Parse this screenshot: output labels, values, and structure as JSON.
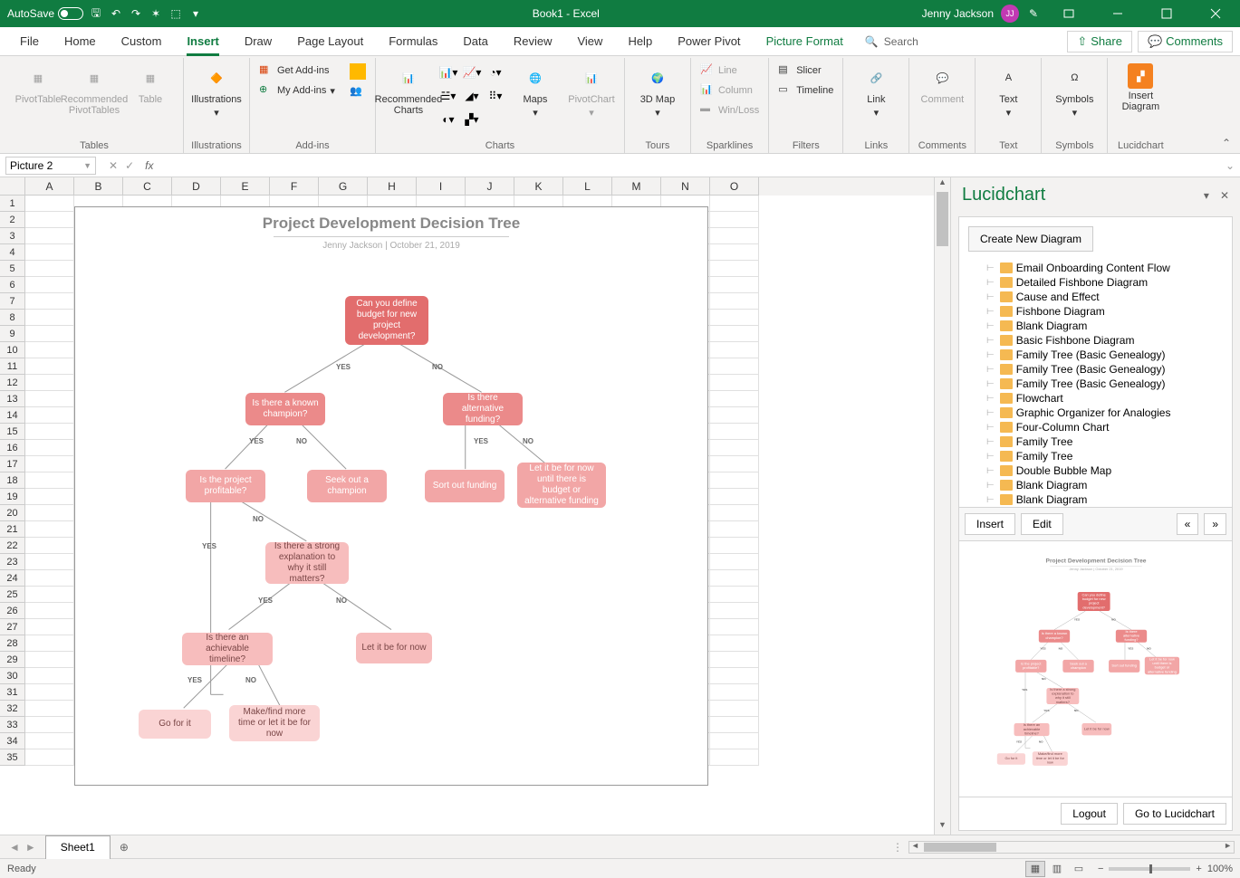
{
  "titlebar": {
    "autosave": "AutoSave",
    "title": "Book1 - Excel",
    "user_name": "Jenny Jackson",
    "user_initials": "JJ"
  },
  "tabs": [
    "File",
    "Home",
    "Custom",
    "Insert",
    "Draw",
    "Page Layout",
    "Formulas",
    "Data",
    "Review",
    "View",
    "Help",
    "Power Pivot",
    "Picture Format"
  ],
  "active_tab": "Insert",
  "search": "Search",
  "share": "Share",
  "comments": "Comments",
  "ribbon": {
    "tables": {
      "pivot": "PivotTable",
      "rec": "Recommended PivotTables",
      "table": "Table",
      "label": "Tables"
    },
    "illustrations": {
      "btn": "Illustrations",
      "label": "Illustrations"
    },
    "addins": {
      "get": "Get Add-ins",
      "my": "My Add-ins",
      "label": "Add-ins"
    },
    "charts": {
      "rec": "Recommended Charts",
      "maps": "Maps",
      "pivotchart": "PivotChart",
      "label": "Charts"
    },
    "tours": {
      "btn": "3D Map",
      "label": "Tours"
    },
    "sparklines": {
      "line": "Line",
      "column": "Column",
      "winloss": "Win/Loss",
      "label": "Sparklines"
    },
    "filters": {
      "slicer": "Slicer",
      "timeline": "Timeline",
      "label": "Filters"
    },
    "links": {
      "btn": "Link",
      "label": "Links"
    },
    "comments": {
      "btn": "Comment",
      "label": "Comments"
    },
    "text": {
      "btn": "Text",
      "label": "Text"
    },
    "symbols": {
      "btn": "Symbols",
      "label": "Symbols"
    },
    "lucid": {
      "btn": "Insert Diagram",
      "label": "Lucidchart"
    }
  },
  "namebox": "Picture 2",
  "columns": [
    "A",
    "B",
    "C",
    "D",
    "E",
    "F",
    "G",
    "H",
    "I",
    "J",
    "K",
    "L",
    "M",
    "N",
    "O"
  ],
  "diagram": {
    "title": "Project Development Decision Tree",
    "subtitle": "Jenny Jackson  |  October 21, 2019",
    "nodes": {
      "root": "Can you define budget for new project development?",
      "champion": "Is there a known champion?",
      "altfund": "Is there alternative funding?",
      "profitable": "Is the project profitable?",
      "seek": "Seek out a champion",
      "sortfund": "Sort out funding",
      "letbudget": "Let it be for now until there is budget or alternative funding",
      "strong": "Is there a strong explanation to why it still matters?",
      "letnow": "Let it be for now",
      "timeline": "Is there an achievable timeline?",
      "gofor": "Go for it",
      "maketime": "Make/find more time or let it be for now"
    },
    "labels": {
      "yes": "YES",
      "no": "NO"
    }
  },
  "pane": {
    "title": "Lucidchart",
    "create": "Create New Diagram",
    "items": [
      "Email Onboarding Content Flow",
      "Detailed Fishbone Diagram",
      "Cause and Effect",
      "Fishbone Diagram",
      "Blank Diagram",
      "Basic Fishbone Diagram",
      "Family Tree (Basic Genealogy)",
      "Family Tree (Basic Genealogy)",
      "Family Tree (Basic Genealogy)",
      "Flowchart",
      "Graphic Organizer for Analogies",
      "Four-Column Chart",
      "Family Tree",
      "Family Tree",
      "Double Bubble Map",
      "Blank Diagram",
      "Blank Diagram"
    ],
    "insert": "Insert",
    "edit": "Edit",
    "logout": "Logout",
    "goto": "Go to Lucidchart"
  },
  "sheet": "Sheet1",
  "status": "Ready",
  "zoom": "100%"
}
